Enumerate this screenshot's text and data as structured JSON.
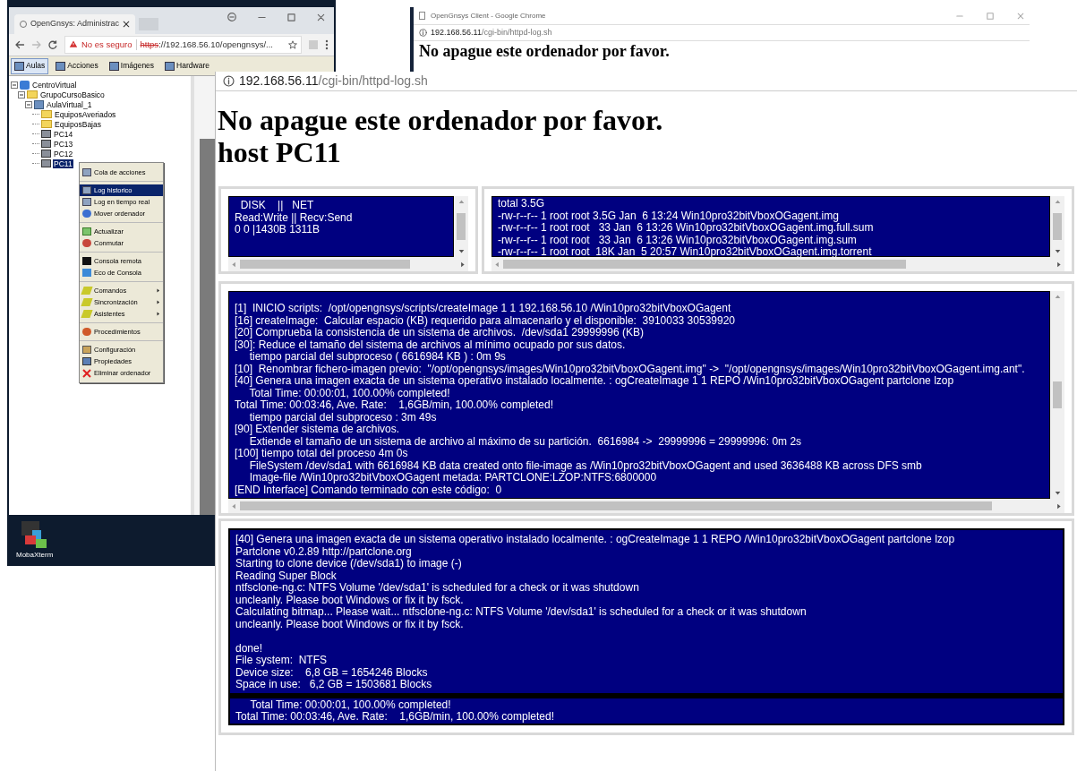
{
  "admin_window": {
    "tab_title": "OpenGnsys: Administrac",
    "security": "No es seguro",
    "url_scheme": "https",
    "url_rest": "://192.168.56.10/opengnsys/...",
    "toolbar": [
      {
        "label": "Aulas",
        "selected": true
      },
      {
        "label": "Acciones",
        "selected": false
      },
      {
        "label": "Imágenes",
        "selected": false
      },
      {
        "label": "Hardware",
        "selected": false
      }
    ],
    "tree": [
      {
        "label": "CentroVirtual",
        "kind": "center",
        "selected": false,
        "expanded": true,
        "children": [
          {
            "label": "GrupoCursoBasico",
            "kind": "folder",
            "selected": false,
            "expanded": true,
            "children": [
              {
                "label": "AulaVirtual_1",
                "kind": "classroom",
                "selected": false,
                "expanded": true,
                "children": [
                  {
                    "label": "EquiposAveriados",
                    "kind": "folder",
                    "selected": false
                  },
                  {
                    "label": "EquiposBajas",
                    "kind": "folder",
                    "selected": false
                  },
                  {
                    "label": "PC14",
                    "kind": "computer",
                    "selected": false
                  },
                  {
                    "label": "PC13",
                    "kind": "computer",
                    "selected": false
                  },
                  {
                    "label": "PC12",
                    "kind": "computer",
                    "selected": false
                  },
                  {
                    "label": "PC11",
                    "kind": "computer",
                    "selected": true
                  }
                ]
              }
            ]
          }
        ]
      }
    ],
    "context_menu": [
      [
        {
          "label": "Cola de acciones",
          "selected": false,
          "submenu": false
        }
      ],
      [
        {
          "label": "Log historico",
          "selected": true,
          "submenu": false
        },
        {
          "label": "Log en tiempo real",
          "selected": false,
          "submenu": false
        },
        {
          "label": "Mover ordenador",
          "selected": false,
          "submenu": false
        }
      ],
      [
        {
          "label": "Actualizar",
          "selected": false,
          "submenu": false
        },
        {
          "label": "Conmutar",
          "selected": false,
          "submenu": false
        }
      ],
      [
        {
          "label": "Consola remota",
          "selected": false,
          "submenu": false
        },
        {
          "label": "Eco de Consola",
          "selected": false,
          "submenu": false
        }
      ],
      [
        {
          "label": "Comandos",
          "selected": false,
          "submenu": true
        },
        {
          "label": "Sincronización",
          "selected": false,
          "submenu": true
        },
        {
          "label": "Asistentes",
          "selected": false,
          "submenu": true
        }
      ],
      [
        {
          "label": "Procedimientos",
          "selected": false,
          "submenu": false
        }
      ],
      [
        {
          "label": "Configuración",
          "selected": false,
          "submenu": false
        },
        {
          "label": "Propiedades",
          "selected": false,
          "submenu": false
        },
        {
          "label": "Eliminar ordenador",
          "selected": false,
          "submenu": false
        }
      ]
    ]
  },
  "desktop_icon": {
    "label": "MobaXterm"
  },
  "client_window": {
    "title": "OpenGnsys Client - Google Chrome",
    "url_host": "192.168.56.11",
    "url_path": "/cgi-bin/httpd-log.sh",
    "heading": "No apague este ordenador por favor."
  },
  "log_page": {
    "url_host": "192.168.56.11",
    "url_path": "/cgi-bin/httpd-log.sh",
    "heading_lines": [
      "No apague este ordenador por favor.",
      "host PC11"
    ],
    "disk_lines": [
      "  DISK    ||   NET",
      "Read:Write || Recv:Send",
      "0 0 |1430B 1311B"
    ],
    "file_lines": [
      "total 3.5G",
      "-rw-r--r-- 1 root root 3.5G Jan  6 13:24 Win10pro32bitVboxOGagent.img",
      "-rw-r--r-- 1 root root   33 Jan  6 13:26 Win10pro32bitVboxOGagent.img.full.sum",
      "-rw-r--r-- 1 root root   33 Jan  6 13:26 Win10pro32bitVboxOGagent.img.sum",
      "-rw-r--r-- 1 root root  18K Jan  5 20:57 Win10pro32bitVboxOGagent.img.torrent"
    ],
    "log_lines": [
      "[1]  INICIO scripts:  /opt/opengnsys/scripts/createImage 1 1 192.168.56.10 /Win10pro32bitVboxOGagent",
      "[16] createImage:  Calcular espacio (KB) requerido para almacenarlo y el disponible:  3910033 30539920",
      "[20] Comprueba la consistencia de un sistema de archivos.  /dev/sda1 29999996 (KB)",
      "[30]: Reduce el tamaño del sistema de archivos al mínimo ocupado por sus datos.",
      "     tiempo parcial del subproceso ( 6616984 KB ) : 0m 9s",
      "[10]  Renombrar fichero-imagen previo:  \"/opt/opengnsys/images/Win10pro32bitVboxOGagent.img\" ->  \"/opt/opengnsys/images/Win10pro32bitVboxOGagent.img.ant\".",
      "[40] Genera una imagen exacta de un sistema operativo instalado localmente. : ogCreateImage 1 1 REPO /Win10pro32bitVboxOGagent partclone lzop",
      "     Total Time: 00:00:01, 100.00% completed!",
      "Total Time: 00:03:46, Ave. Rate:    1,6GB/min, 100.00% completed!",
      "     tiempo parcial del subproceso : 3m 49s",
      "[90] Extender sistema de archivos.",
      "     Extiende el tamaño de un sistema de archivo al máximo de su partición.  6616984 ->  29999996 = 29999996: 0m 2s",
      "[100] tiempo total del proceso 4m 0s",
      "     FileSystem /dev/sda1 with 6616984 KB data created onto file-image as /Win10pro32bitVboxOGagent and used 3636488 KB across DFS smb",
      "     Image-file /Win10pro32bitVboxOGagent metada: PARTCLONE:LZOP:NTFS:6800000",
      "[END Interface] Comando terminado con este código:  0"
    ],
    "clone_lines": [
      "[40] Genera una imagen exacta de un sistema operativo instalado localmente. : ogCreateImage 1 1 REPO /Win10pro32bitVboxOGagent partclone lzop",
      "Partclone v0.2.89 http://partclone.org",
      "Starting to clone device (/dev/sda1) to image (-)",
      "Reading Super Block",
      "ntfsclone-ng.c: NTFS Volume '/dev/sda1' is scheduled for a check or it was shutdown",
      "uncleanly. Please boot Windows or fix it by fsck.",
      "Calculating bitmap... Please wait... ntfsclone-ng.c: NTFS Volume '/dev/sda1' is scheduled for a check or it was shutdown",
      "uncleanly. Please boot Windows or fix it by fsck.",
      "done!",
      "File system:  NTFS",
      "Device size:    6,8 GB = 1654246 Blocks",
      "Space in use:   6,2 GB = 1503681 Blocks"
    ],
    "summary_lines": [
      "     Total Time: 00:00:01, 100.00% completed!",
      "Total Time: 00:03:46, Ave. Rate:    1,6GB/min, 100.00% completed!"
    ]
  }
}
